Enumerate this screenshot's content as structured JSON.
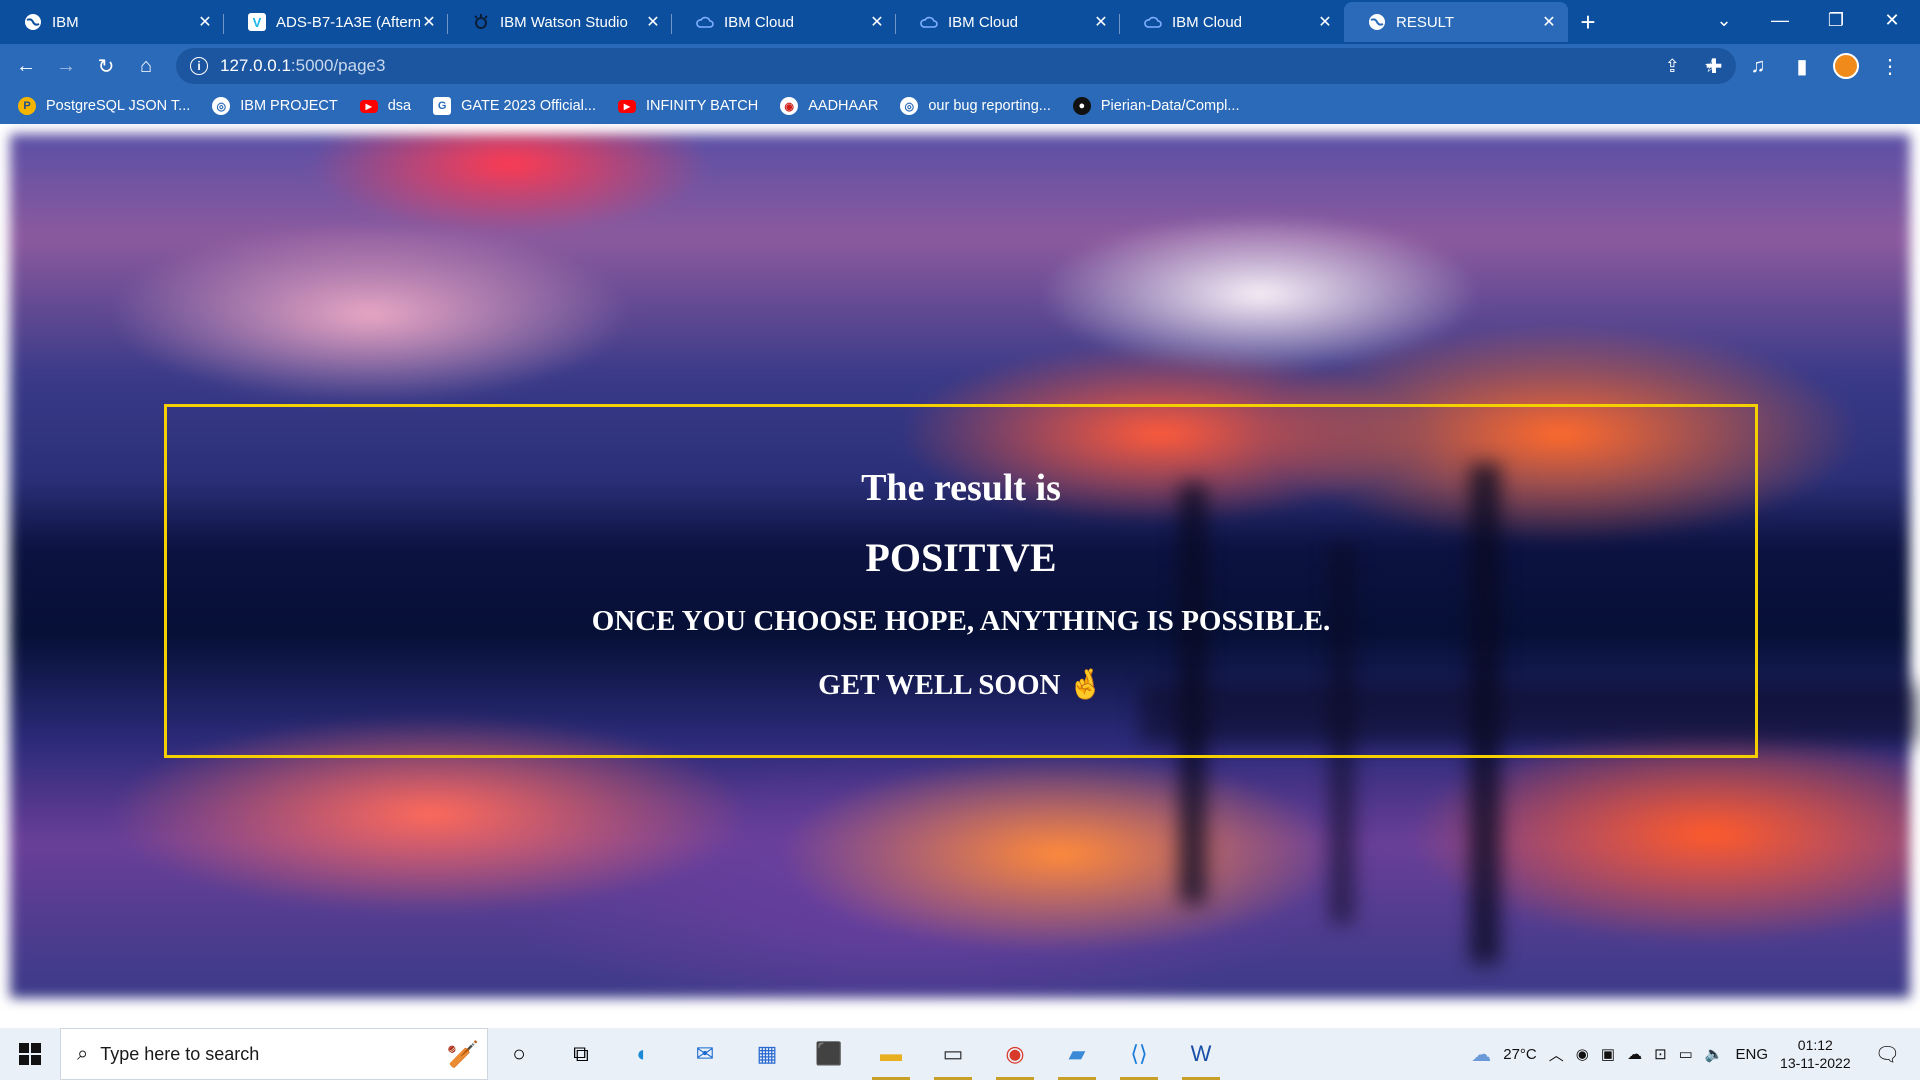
{
  "tabs": [
    {
      "title": "IBM",
      "icon": "globe-icon"
    },
    {
      "title": "ADS-B7-1A3E (Aftern",
      "icon": "vimeo-icon"
    },
    {
      "title": "IBM Watson Studio",
      "icon": "watson-icon"
    },
    {
      "title": "IBM Cloud",
      "icon": "cloud-icon"
    },
    {
      "title": "IBM Cloud",
      "icon": "cloud-icon"
    },
    {
      "title": "IBM Cloud",
      "icon": "cloud-icon"
    },
    {
      "title": "RESULT",
      "icon": "globe-icon"
    }
  ],
  "address": {
    "host": "127.0.0.1",
    "path": ":5000/page3"
  },
  "bookmarks": [
    {
      "label": "PostgreSQL JSON T...",
      "icon": "postgres-icon"
    },
    {
      "label": "IBM PROJECT",
      "icon": "globe-icon"
    },
    {
      "label": "dsa",
      "icon": "youtube-icon"
    },
    {
      "label": "GATE 2023 Official...",
      "icon": "gate-icon"
    },
    {
      "label": "INFINITY BATCH",
      "icon": "youtube-icon"
    },
    {
      "label": "AADHAAR",
      "icon": "aadhaar-icon"
    },
    {
      "label": "our bug reporting...",
      "icon": "globe-icon"
    },
    {
      "label": "Pierian-Data/Compl...",
      "icon": "github-icon"
    }
  ],
  "result": {
    "heading": "The result is",
    "status": "POSITIVE",
    "quote": "ONCE YOU CHOOSE HOPE, ANYTHING IS POSSIBLE.",
    "wish": "GET WELL SOON 🤞"
  },
  "colors": {
    "border": "#f5d000",
    "chrome": "#2a6ab8",
    "tabbar": "#0b4f9e"
  },
  "taskbar": {
    "search_placeholder": "Type here to search",
    "weather": "27°C",
    "language": "ENG",
    "time": "01:12",
    "date": "13-11-2022"
  }
}
